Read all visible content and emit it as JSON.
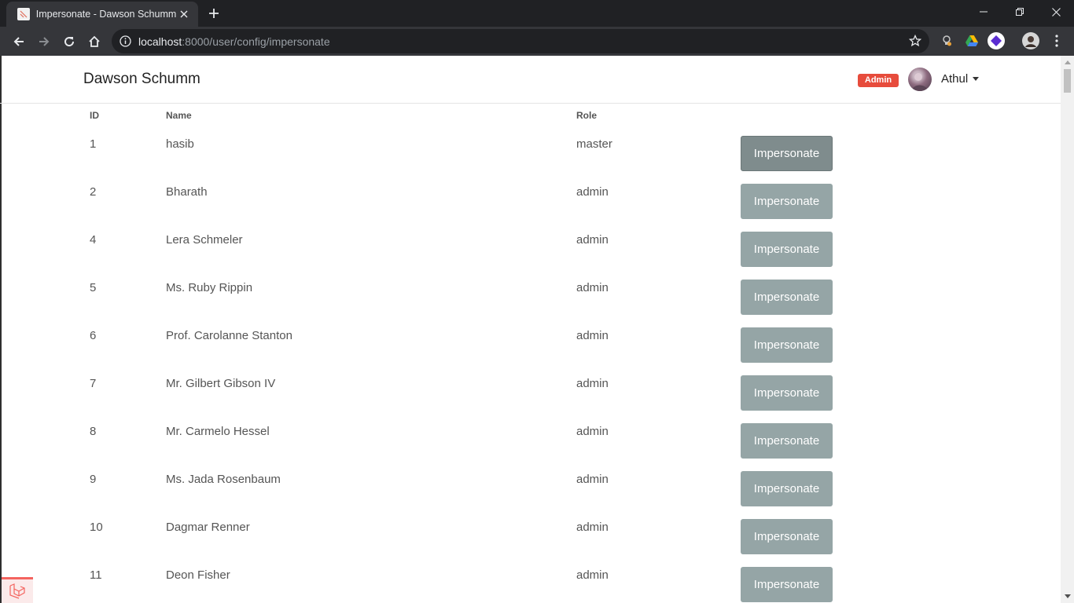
{
  "browser": {
    "tab_title": "Impersonate - Dawson Schumm",
    "url_host": "localhost",
    "url_rest": ":8000/user/config/impersonate"
  },
  "navbar": {
    "brand": "Dawson Schumm",
    "badge": "Admin",
    "user": "Athul"
  },
  "table": {
    "headers": {
      "id": "ID",
      "name": "Name",
      "role": "Role"
    },
    "rows": [
      {
        "id": "1",
        "name": "hasib",
        "role": "master",
        "action": "Impersonate"
      },
      {
        "id": "2",
        "name": "Bharath",
        "role": "admin",
        "action": "Impersonate"
      },
      {
        "id": "4",
        "name": "Lera Schmeler",
        "role": "admin",
        "action": "Impersonate"
      },
      {
        "id": "5",
        "name": "Ms. Ruby Rippin",
        "role": "admin",
        "action": "Impersonate"
      },
      {
        "id": "6",
        "name": "Prof. Carolanne Stanton",
        "role": "admin",
        "action": "Impersonate"
      },
      {
        "id": "7",
        "name": "Mr. Gilbert Gibson IV",
        "role": "admin",
        "action": "Impersonate"
      },
      {
        "id": "8",
        "name": "Mr. Carmelo Hessel",
        "role": "admin",
        "action": "Impersonate"
      },
      {
        "id": "9",
        "name": "Ms. Jada Rosenbaum",
        "role": "admin",
        "action": "Impersonate"
      },
      {
        "id": "10",
        "name": "Dagmar Renner",
        "role": "admin",
        "action": "Impersonate"
      },
      {
        "id": "11",
        "name": "Deon Fisher",
        "role": "admin",
        "action": "Impersonate"
      }
    ]
  },
  "colors": {
    "badge": "#e74c3c",
    "button": "#95a5a6",
    "button_hover": "#7f8c8d"
  }
}
